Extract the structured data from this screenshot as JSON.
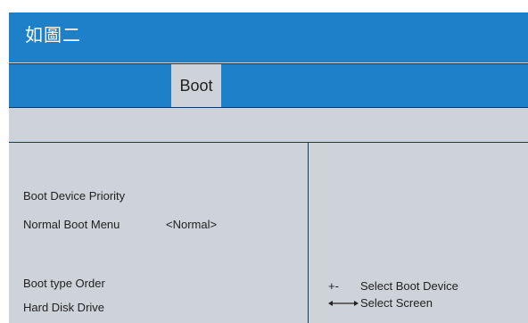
{
  "window": {
    "title": "如圖二"
  },
  "menu": {
    "active_tab": "Boot"
  },
  "left_panel": {
    "items": [
      {
        "label": "Boot Device Priority"
      },
      {
        "label": "Normal Boot Menu",
        "value": "<Normal>"
      },
      {
        "label": "Boot type Order"
      },
      {
        "label": "Hard Disk Drive"
      }
    ]
  },
  "help_panel": {
    "items": [
      {
        "key": "+-",
        "icon": "plus-minus-keys",
        "description": "Select Boot Device"
      },
      {
        "key": "",
        "icon": "left-right-arrow-icon",
        "description": "Select Screen"
      }
    ]
  },
  "colors": {
    "bar_blue": "#1e80c9",
    "panel_gray": "#cdd3d8",
    "line_dark": "#0c3b66"
  }
}
